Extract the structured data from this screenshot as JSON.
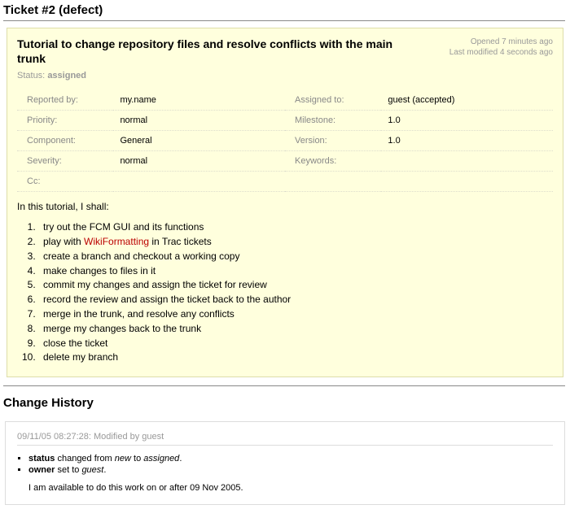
{
  "header": {
    "title": "Ticket #2 (defect)"
  },
  "ticket": {
    "summary": "Tutorial to change repository files and resolve conflicts with the main trunk",
    "opened": "Opened 7 minutes ago",
    "modified": "Last modified 4 seconds ago",
    "status_label": "Status:",
    "status_value": "assigned",
    "props": {
      "reported_by_label": "Reported by:",
      "reported_by_value": "my.name",
      "assigned_to_label": "Assigned to:",
      "assigned_to_value": "guest (accepted)",
      "priority_label": "Priority:",
      "priority_value": "normal",
      "milestone_label": "Milestone:",
      "milestone_value": "1.0",
      "component_label": "Component:",
      "component_value": "General",
      "version_label": "Version:",
      "version_value": "1.0",
      "severity_label": "Severity:",
      "severity_value": "normal",
      "keywords_label": "Keywords:",
      "keywords_value": "",
      "cc_label": "Cc:",
      "cc_value": ""
    },
    "description": {
      "intro": "In this tutorial, I shall:",
      "items": {
        "i1": "try out the FCM GUI and its functions",
        "i2a": "play with ",
        "i2b": "WikiFormatting",
        "i2c": " in Trac tickets",
        "i3": "create a branch and checkout a working copy",
        "i4": "make changes to files in it",
        "i5": "commit my changes and assign the ticket for review",
        "i6": "record the review and assign the ticket back to the author",
        "i7": "merge in the trunk, and resolve any conflicts",
        "i8": "merge my changes back to the trunk",
        "i9": "close the ticket",
        "i10": "delete my branch"
      }
    }
  },
  "history": {
    "header": "Change History",
    "entry1": {
      "meta": "09/11/05 08:27:28: Modified by guest",
      "status_field": "status",
      "status_text_a": " changed from ",
      "status_from": "new",
      "status_text_b": " to ",
      "status_to": "assigned",
      "status_dot": ".",
      "owner_field": "owner",
      "owner_text_a": " set to ",
      "owner_value": "guest",
      "owner_dot": ".",
      "comment": "I am available to do this work on or after 09 Nov 2005."
    }
  }
}
